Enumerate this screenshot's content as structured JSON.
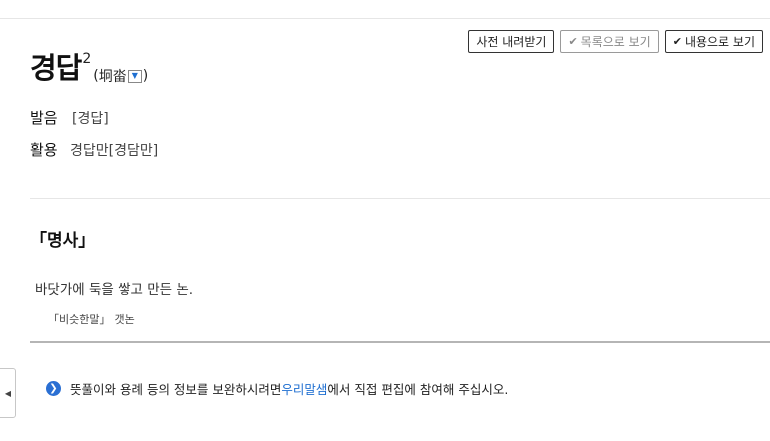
{
  "toolbar": {
    "download_label": "사전 내려받기",
    "list_view_label": "목록으로 보기",
    "content_view_label": "내용으로 보기"
  },
  "entry": {
    "headword": "경답",
    "homonym_number": "2",
    "hanja_open": "(",
    "hanja": "坰畓",
    "hanja_close": ")",
    "pronunciation_label": "발음",
    "pronunciation": "[경답]",
    "conjugation_label": "활용",
    "conjugation": "경답만[경담만]"
  },
  "sense": {
    "part_of_speech": "「명사」",
    "definition": "바닷가에 둑을 쌓고 만든 논.",
    "synonym_label": "「비슷한말」",
    "synonym": "갯논"
  },
  "notice": {
    "prefix": "뜻풀이와 용례 등의 정보를 보완하시려면 ",
    "link": "우리말샘",
    "suffix": "에서 직접 편집에 참여해 주십시오."
  },
  "icons": {
    "check": "check-icon",
    "dropdown": "triangle-down-icon",
    "info": "chevron-right-circle-icon",
    "side_handle": "triangle-left-icon"
  },
  "colors": {
    "link": "#1f6fd1",
    "info_icon": "#2a6fd3"
  }
}
